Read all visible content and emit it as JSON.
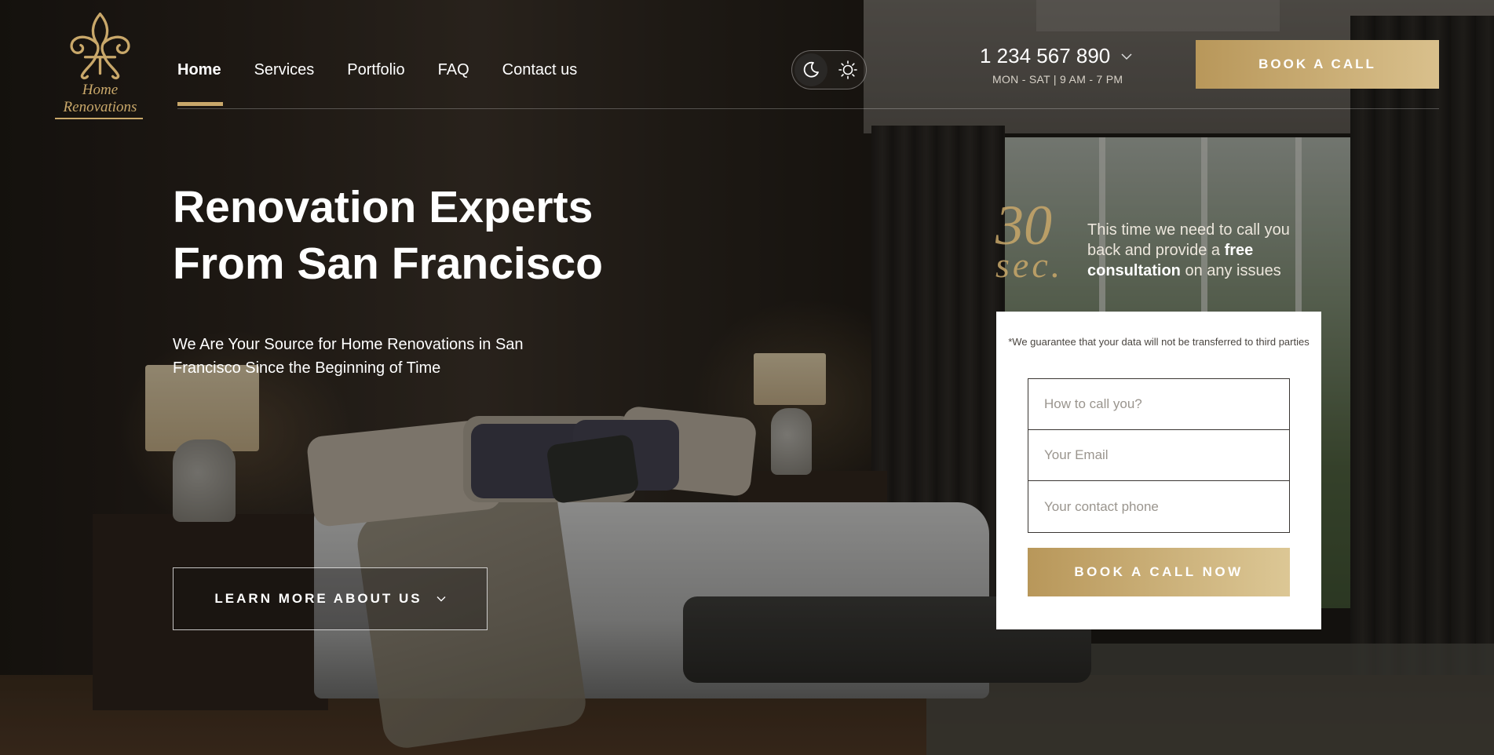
{
  "brand": {
    "logo_line1": "Home",
    "logo_line2": "Renovations",
    "icon": "fleur-de-lis-icon"
  },
  "nav": {
    "items": [
      {
        "label": "Home",
        "active": true
      },
      {
        "label": "Services"
      },
      {
        "label": "Portfolio"
      },
      {
        "label": "FAQ"
      },
      {
        "label": "Contact us"
      }
    ]
  },
  "theme_toggle": {
    "dark_icon": "moon-icon",
    "light_icon": "sun-icon",
    "selected": "dark"
  },
  "contact": {
    "phone": "1 234 567 890",
    "hours": "MON - SAT | 9 AM - 7 PM"
  },
  "header_cta": {
    "label": "BOOK A CALL"
  },
  "hero": {
    "title_line1": "Renovation Experts",
    "title_line2": "From San Francisco",
    "subtitle": "We Are Your Source for Home Renovations in San Francisco Since the Beginning of Time",
    "learn_more_label": "LEARN MORE ABOUT US"
  },
  "promo": {
    "number": "30",
    "unit": "sec.",
    "text_before": "This time we need to call you back and provide a ",
    "text_bold": "free consultation",
    "text_after": " on any issues"
  },
  "form": {
    "note": "*We guarantee that your data will not be transferred to third parties",
    "name_placeholder": "How to call you?",
    "email_placeholder": "Your Email",
    "phone_placeholder": "Your contact phone",
    "submit_label": "BOOK A CALL NOW"
  },
  "colors": {
    "accent_gold": "#c9a86a",
    "button_gradient_start": "#b8975a",
    "button_gradient_end": "#d9c08c"
  }
}
